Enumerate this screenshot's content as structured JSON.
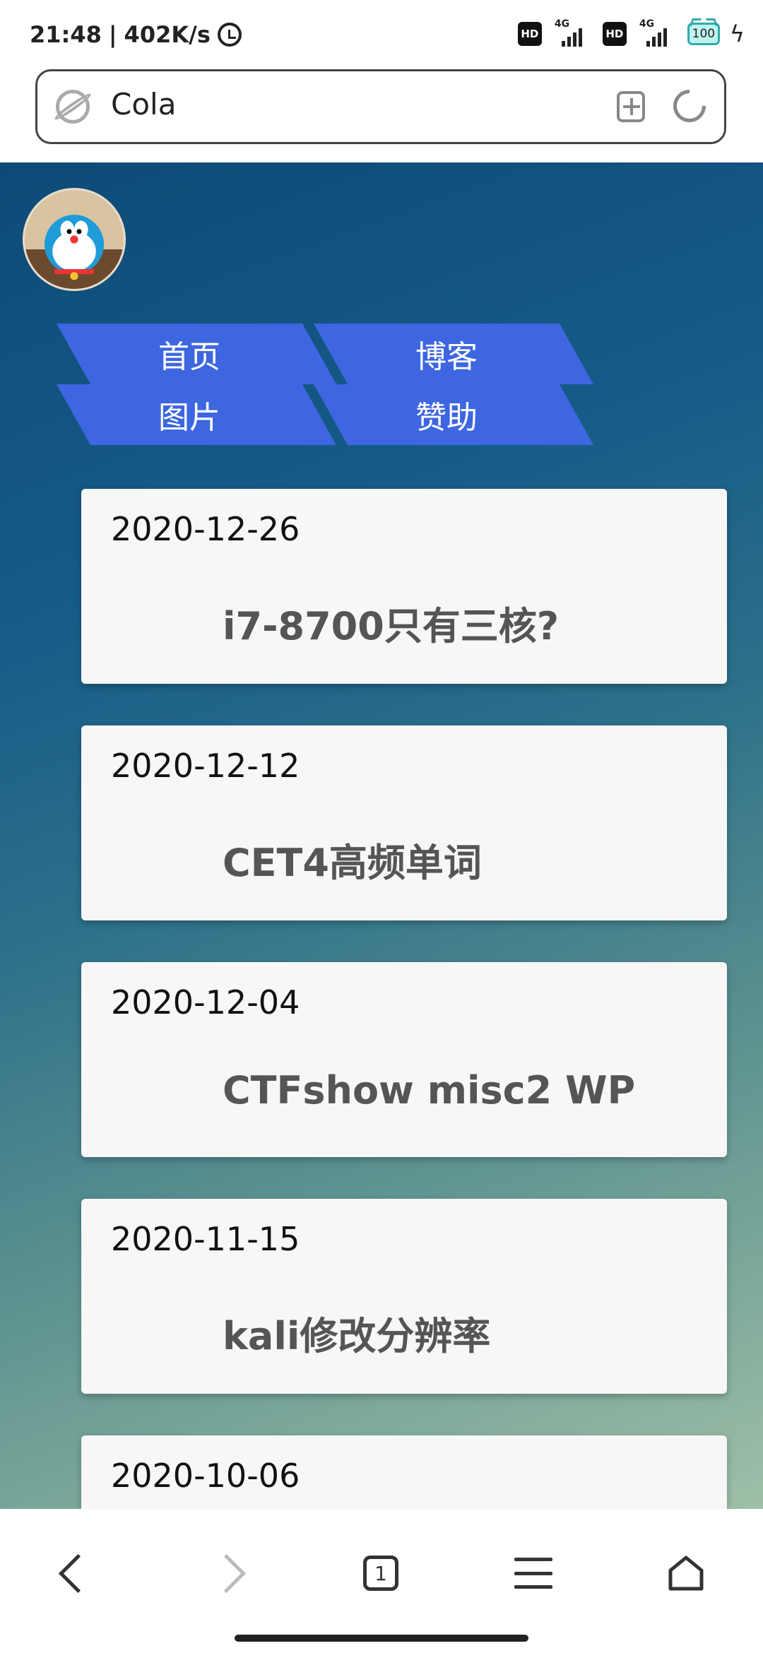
{
  "status_bar": {
    "time": "21:48",
    "speed": "402K/s",
    "hd1": "HD",
    "net1": "4G",
    "hd2": "HD",
    "net2": "4G",
    "battery": "100"
  },
  "address_bar": {
    "url_text": "Cola"
  },
  "nav": {
    "items": [
      "首页",
      "博客",
      "图片",
      "赞助"
    ]
  },
  "posts": [
    {
      "date": "2020-12-26",
      "title": "i7-8700只有三核?"
    },
    {
      "date": "2020-12-12",
      "title": "CET4高频单词"
    },
    {
      "date": "2020-12-04",
      "title": "CTFshow misc2 WP"
    },
    {
      "date": "2020-11-15",
      "title": "kali修改分辨率"
    },
    {
      "date": "2020-10-06",
      "title": ""
    }
  ],
  "bottom_nav": {
    "tab_count": "1"
  },
  "colors": {
    "nav_blue": "#3d66e0",
    "card_bg": "#f7f7f7",
    "page_gradient_start": "#0e4a77",
    "page_gradient_end": "#9fbfa7"
  },
  "icons": [
    "alarm-icon",
    "globe-icon",
    "add-tab-icon",
    "reload-icon",
    "back-icon",
    "forward-icon",
    "tabs-icon",
    "menu-icon",
    "home-icon"
  ]
}
